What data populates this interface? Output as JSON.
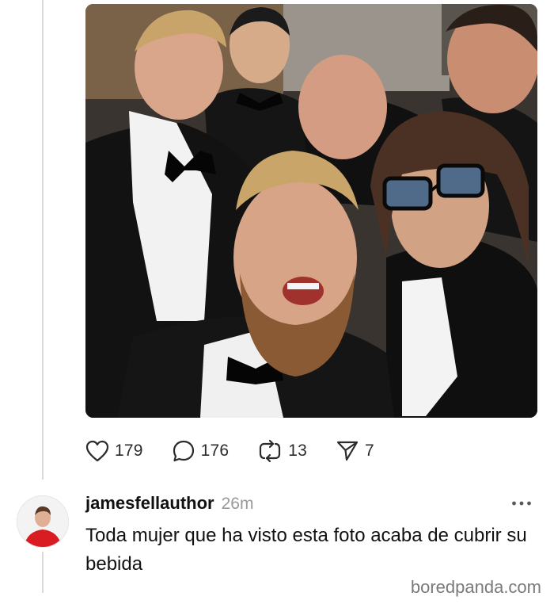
{
  "post": {
    "photo_alt": "group selfie",
    "actions": {
      "likes": "179",
      "comments": "176",
      "reposts": "13",
      "shares": "7"
    },
    "icons": [
      "heart-icon",
      "comment-icon",
      "repost-icon",
      "share-icon"
    ]
  },
  "reply": {
    "username": "jamesfellauthor",
    "time": "26m",
    "text": "Toda mujer que ha visto esta foto acaba de cubrir su bebida",
    "more_icon": "more-options-icon"
  },
  "watermark": "boredpanda.com",
  "colors": {
    "text": "#111111",
    "muted": "#9a9a9a",
    "thread_line": "#d9d9d9",
    "avatar_shirt": "#d91c22"
  }
}
